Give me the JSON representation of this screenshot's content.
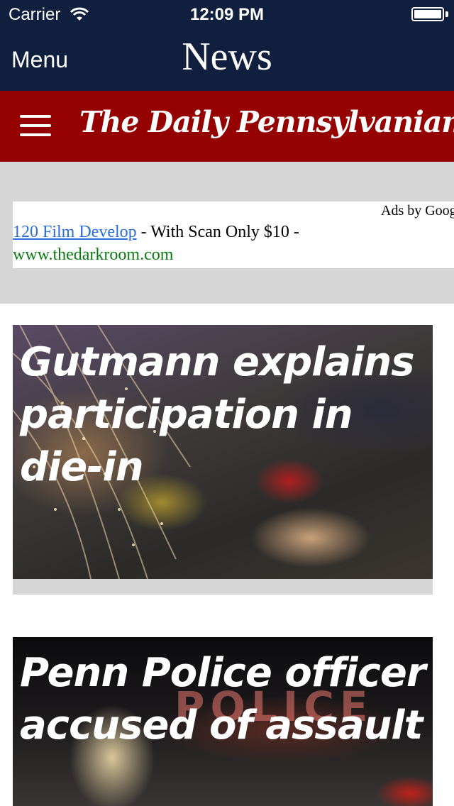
{
  "status_bar": {
    "carrier": "Carrier",
    "time": "12:09 PM",
    "wifi_icon": "wifi-icon",
    "battery_icon": "battery-icon"
  },
  "nav": {
    "menu_label": "Menu",
    "title": "News"
  },
  "masthead": {
    "logo_text": "The Daily Pennsylvanian",
    "menu_icon": "hamburger-icon",
    "color": "#950000"
  },
  "ad": {
    "ads_by": "Ads by Goog",
    "link_text": "120 Film Develop",
    "description": " - With Scan Only $10 -",
    "url": "www.thedarkroom.com"
  },
  "stories": [
    {
      "headline": "Gutmann explains participation in die-in"
    },
    {
      "headline": "Penn Police officer accused of assault",
      "photo_sign": "POLICE"
    }
  ],
  "colors": {
    "nav_background": "#0f1f3d",
    "ad_background": "#d6d6d6",
    "ad_link": "#2a6fdb",
    "ad_url": "#0a7a12"
  }
}
